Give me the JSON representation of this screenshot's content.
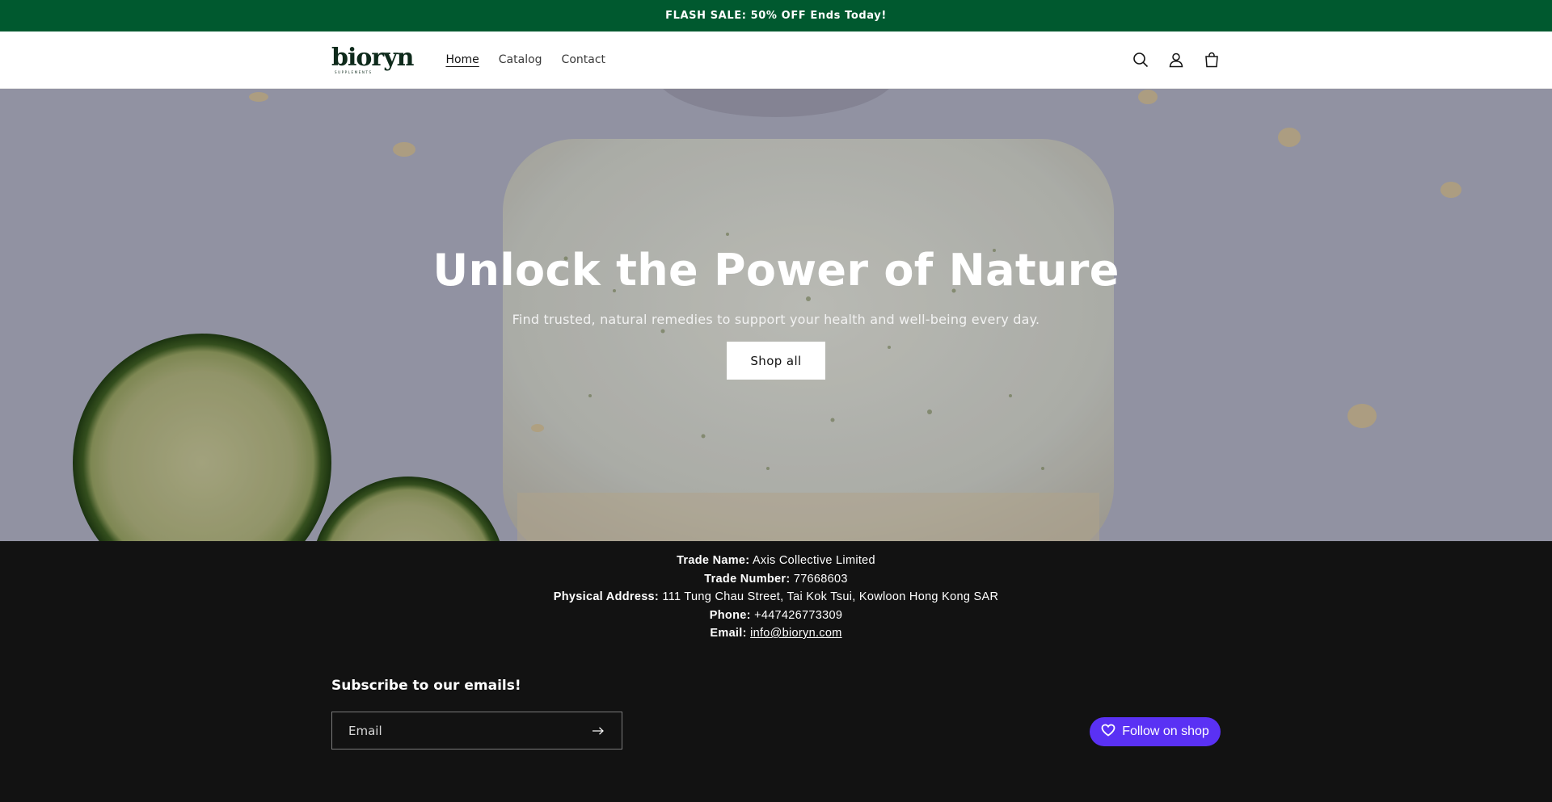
{
  "announcement": {
    "text": "FLASH SALE: 50% OFF Ends Today!"
  },
  "header": {
    "logo": {
      "word": "bioryn",
      "sub": "SUPPLEMENTS"
    },
    "nav": [
      {
        "label": "Home",
        "active": true
      },
      {
        "label": "Catalog",
        "active": false
      },
      {
        "label": "Contact",
        "active": false
      }
    ],
    "icons": [
      "search-icon",
      "account-icon",
      "cart-icon"
    ]
  },
  "hero": {
    "title": "Unlock the Power of Nature",
    "subtitle": "Find trusted, natural remedies to support your health and well-being every day.",
    "button": "Shop all"
  },
  "footer": {
    "trade_name_label": "Trade Name:",
    "trade_name": "Axis Collective Limited",
    "trade_number_label": "Trade Number:",
    "trade_number": "77668603",
    "address_label": "Physical Address:",
    "address": "111 Tung Chau Street, Tai Kok Tsui, Kowloon Hong Kong SAR",
    "phone_label": "Phone:",
    "phone": "+447426773309",
    "email_label": "Email:",
    "email": "info@bioryn.com",
    "subscribe_title": "Subscribe to our emails!",
    "email_placeholder": "Email",
    "follow_label": "Follow on shop"
  },
  "colors": {
    "announcement_bg": "#00592f",
    "footer_bg": "#121212",
    "shop_purple": "#5a31f4"
  }
}
